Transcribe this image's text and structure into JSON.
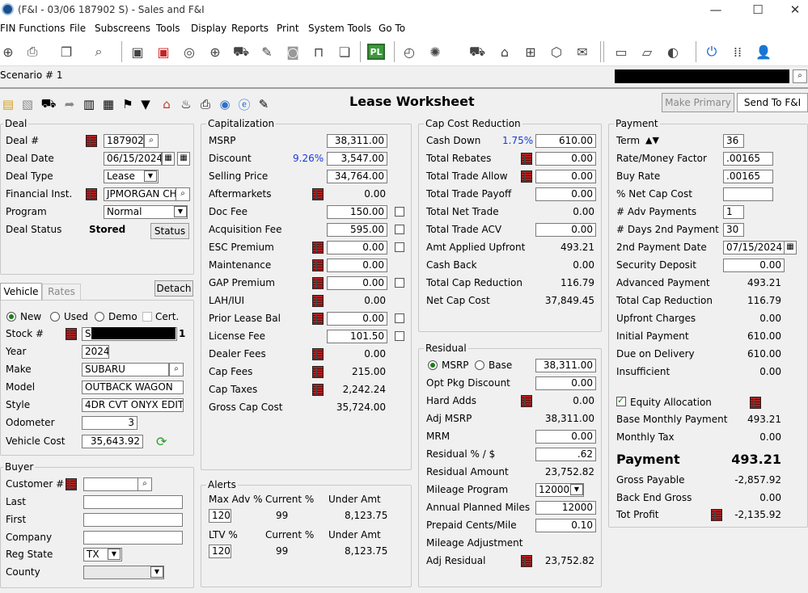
{
  "window": {
    "title": "(F&I - 03/06 187902 S) - Sales and F&I",
    "minimize": "—",
    "maximize": "☐",
    "close": "✕"
  },
  "menu": [
    "FIN Functions",
    "File",
    "Subscreens",
    "Tools",
    "Display",
    "Reports",
    "Print",
    "System Tools",
    "Go To"
  ],
  "scenario": "Scenario # 1",
  "worksheet_title": "Lease Worksheet",
  "buttons": {
    "make_primary": "Make Primary",
    "send_fi": "Send To F&I",
    "status": "Status",
    "detach": "Detach"
  },
  "deal": {
    "title": "Deal",
    "labels": {
      "deal_no": "Deal #",
      "deal_date": "Deal Date",
      "deal_type": "Deal Type",
      "fin_inst": "Financial Inst.",
      "program": "Program",
      "status": "Deal Status"
    },
    "deal_no": "187902",
    "deal_date": "06/15/2024",
    "deal_type": "Lease",
    "fin_inst": "JPMORGAN CHA",
    "program": "Normal",
    "status": "Stored"
  },
  "vehicle": {
    "tabs": [
      "Vehicle",
      "Rates"
    ],
    "radios": [
      "New",
      "Used",
      "Demo"
    ],
    "cert": "Cert.",
    "labels": {
      "stock": "Stock #",
      "year": "Year",
      "make": "Make",
      "model": "Model",
      "style": "Style",
      "odometer": "Odometer",
      "cost": "Vehicle Cost"
    },
    "stock_prefix": "S",
    "stock_suffix": "1",
    "year": "2024",
    "make": "SUBARU",
    "model": "OUTBACK WAGON",
    "style": "4DR CVT ONYX EDITI",
    "odometer": "3",
    "cost": "35,643.92"
  },
  "buyer": {
    "title": "Buyer",
    "labels": {
      "customer": "Customer #",
      "last": "Last",
      "first": "First",
      "company": "Company",
      "reg_state": "Reg State",
      "county": "County"
    },
    "reg_state": "TX"
  },
  "capitalization": {
    "title": "Capitalization",
    "rows": [
      {
        "label": "MSRP",
        "value": "38,311.00",
        "input": true
      },
      {
        "label": "Discount",
        "value": "3,547.00",
        "input": true,
        "pct": "9.26%"
      },
      {
        "label": "Selling Price",
        "value": "34,764.00",
        "input": true
      },
      {
        "label": "Aftermarkets",
        "value": "0.00",
        "book": true
      },
      {
        "label": "Doc Fee",
        "value": "150.00",
        "input": true,
        "chk": true
      },
      {
        "label": "Acquisition Fee",
        "value": "595.00",
        "input": true,
        "chk": true
      },
      {
        "label": "ESC Premium",
        "value": "0.00",
        "input": true,
        "book": true,
        "chk": true
      },
      {
        "label": "Maintenance",
        "value": "0.00",
        "input": true,
        "book": true
      },
      {
        "label": "GAP Premium",
        "value": "0.00",
        "input": true,
        "book": true,
        "chk": true
      },
      {
        "label": "LAH/IUI",
        "value": "0.00",
        "book": true
      },
      {
        "label": "Prior Lease Bal",
        "value": "0.00",
        "input": true,
        "book": true,
        "chk": true
      },
      {
        "label": "License Fee",
        "value": "101.50",
        "input": true,
        "chk": true
      },
      {
        "label": "Dealer Fees",
        "value": "0.00",
        "book": true
      },
      {
        "label": "Cap Fees",
        "value": "215.00",
        "book": true
      },
      {
        "label": "Cap Taxes",
        "value": "2,242.24",
        "book": true
      },
      {
        "label": "Gross Cap Cost",
        "value": "35,724.00"
      }
    ]
  },
  "alerts": {
    "title": "Alerts",
    "max_adv_label": "Max Adv %",
    "max_adv": "120",
    "ltv_label": "LTV %",
    "ltv": "120",
    "current_label": "Current %",
    "under_label": "Under Amt",
    "current1": "99",
    "under1": "8,123.75",
    "current2": "99",
    "under2": "8,123.75"
  },
  "cap_reduction": {
    "title": "Cap Cost Reduction",
    "rows": [
      {
        "label": "Cash Down",
        "value": "610.00",
        "input": true,
        "pct": "1.75%"
      },
      {
        "label": "Total Rebates",
        "value": "0.00",
        "input": true,
        "book": true
      },
      {
        "label": "Total Trade Allow",
        "value": "0.00",
        "input": true,
        "book": true
      },
      {
        "label": "Total Trade Payoff",
        "value": "0.00",
        "input": true
      },
      {
        "label": "Total Net Trade",
        "value": "0.00"
      },
      {
        "label": "Total Trade ACV",
        "value": "0.00",
        "input": true
      },
      {
        "label": "Amt Applied Upfront",
        "value": "493.21"
      },
      {
        "label": "Cash Back",
        "value": "0.00"
      },
      {
        "label": "Total Cap Reduction",
        "value": "116.79"
      },
      {
        "label": "Net Cap Cost",
        "value": "37,849.45"
      }
    ]
  },
  "residual": {
    "title": "Residual",
    "msrp_radio": "MSRP",
    "base_radio": "Base",
    "msrp_value": "38,311.00",
    "rows": [
      {
        "label": "Opt Pkg Discount",
        "value": "0.00",
        "input": true
      },
      {
        "label": "Hard Adds",
        "value": "0.00",
        "book": true
      },
      {
        "label": "Adj MSRP",
        "value": "38,311.00"
      },
      {
        "label": "MRM",
        "value": "0.00",
        "input": true
      },
      {
        "label": "Residual % / $",
        "value": ".62",
        "input": true
      },
      {
        "label": "Residual Amount",
        "value": "23,752.82"
      },
      {
        "label": "Mileage Program",
        "value": "12000",
        "select": true
      },
      {
        "label": "Annual Planned Miles",
        "value": "12000",
        "input": true
      },
      {
        "label": "Prepaid Cents/Mile",
        "value": "0.10",
        "input": true
      },
      {
        "label": "Mileage Adjustment",
        "value": ""
      },
      {
        "label": "Adj Residual",
        "value": "23,752.82",
        "book": true
      }
    ]
  },
  "payment": {
    "title": "Payment",
    "term_label": "Term",
    "term": "36",
    "rows_top": [
      {
        "label": "Rate/Money Factor",
        "value": ".00165"
      },
      {
        "label": "Buy Rate",
        "value": ".00165"
      },
      {
        "label": "% Net Cap Cost",
        "value": ""
      },
      {
        "label": "# Adv Payments",
        "value": "1"
      },
      {
        "label": "# Days 2nd Payment",
        "value": "30"
      }
    ],
    "second_date_label": "2nd Payment Date",
    "second_date": "07/15/2024",
    "security_label": "Security Deposit",
    "security": "0.00",
    "rows_mid": [
      {
        "label": "Advanced Payment",
        "value": "493.21"
      },
      {
        "label": "Total Cap Reduction",
        "value": "116.79"
      },
      {
        "label": "Upfront Charges",
        "value": "0.00"
      },
      {
        "label": "Initial Payment",
        "value": "610.00"
      },
      {
        "label": "Due on Delivery",
        "value": "610.00"
      },
      {
        "label": "Insufficient",
        "value": "0.00"
      }
    ],
    "equity_label": "Equity Allocation",
    "base_label": "Base Monthly Payment",
    "base": "493.21",
    "tax_label": "Monthly Tax",
    "tax": "0.00",
    "payment_label": "Payment",
    "payment": "493.21",
    "gross_label": "Gross Payable",
    "gross": "-2,857.92",
    "backend_label": "Back End Gross",
    "backend": "0.00",
    "profit_label": "Tot Profit",
    "profit": "-2,135.92"
  }
}
